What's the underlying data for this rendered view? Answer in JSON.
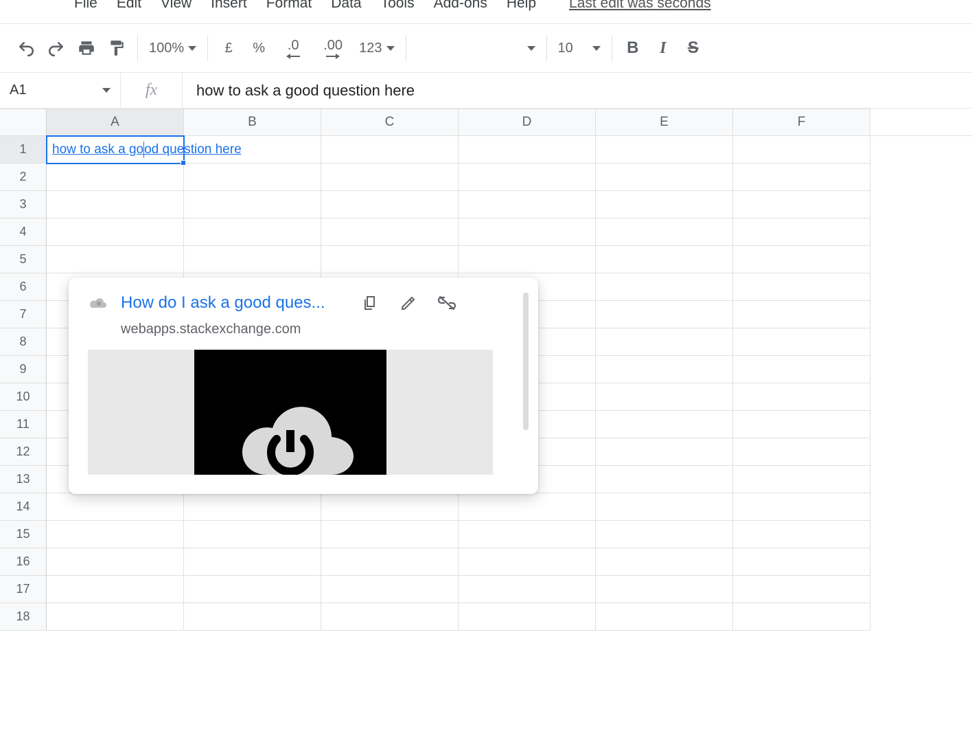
{
  "menus": [
    "File",
    "Edit",
    "View",
    "Insert",
    "Format",
    "Data",
    "Tools",
    "Add-ons",
    "Help"
  ],
  "last_edit": "Last edit was seconds",
  "toolbar": {
    "zoom": "100%",
    "currency": "£",
    "percent": "%",
    "dec_less": ".0",
    "dec_more": ".00",
    "fmt_more": "123",
    "font_size": "10"
  },
  "namebox": "A1",
  "fx_label": "fx",
  "formula_value": "how to ask a good question here",
  "columns": [
    "A",
    "B",
    "C",
    "D",
    "E",
    "F"
  ],
  "row_count": 18,
  "active_cell": {
    "row": 1,
    "col": "A",
    "text_before": "how to ask a go",
    "text_after": "od question here"
  },
  "link_card": {
    "title": "How do I ask a good ques...",
    "domain": "webapps.stackexchange.com"
  }
}
